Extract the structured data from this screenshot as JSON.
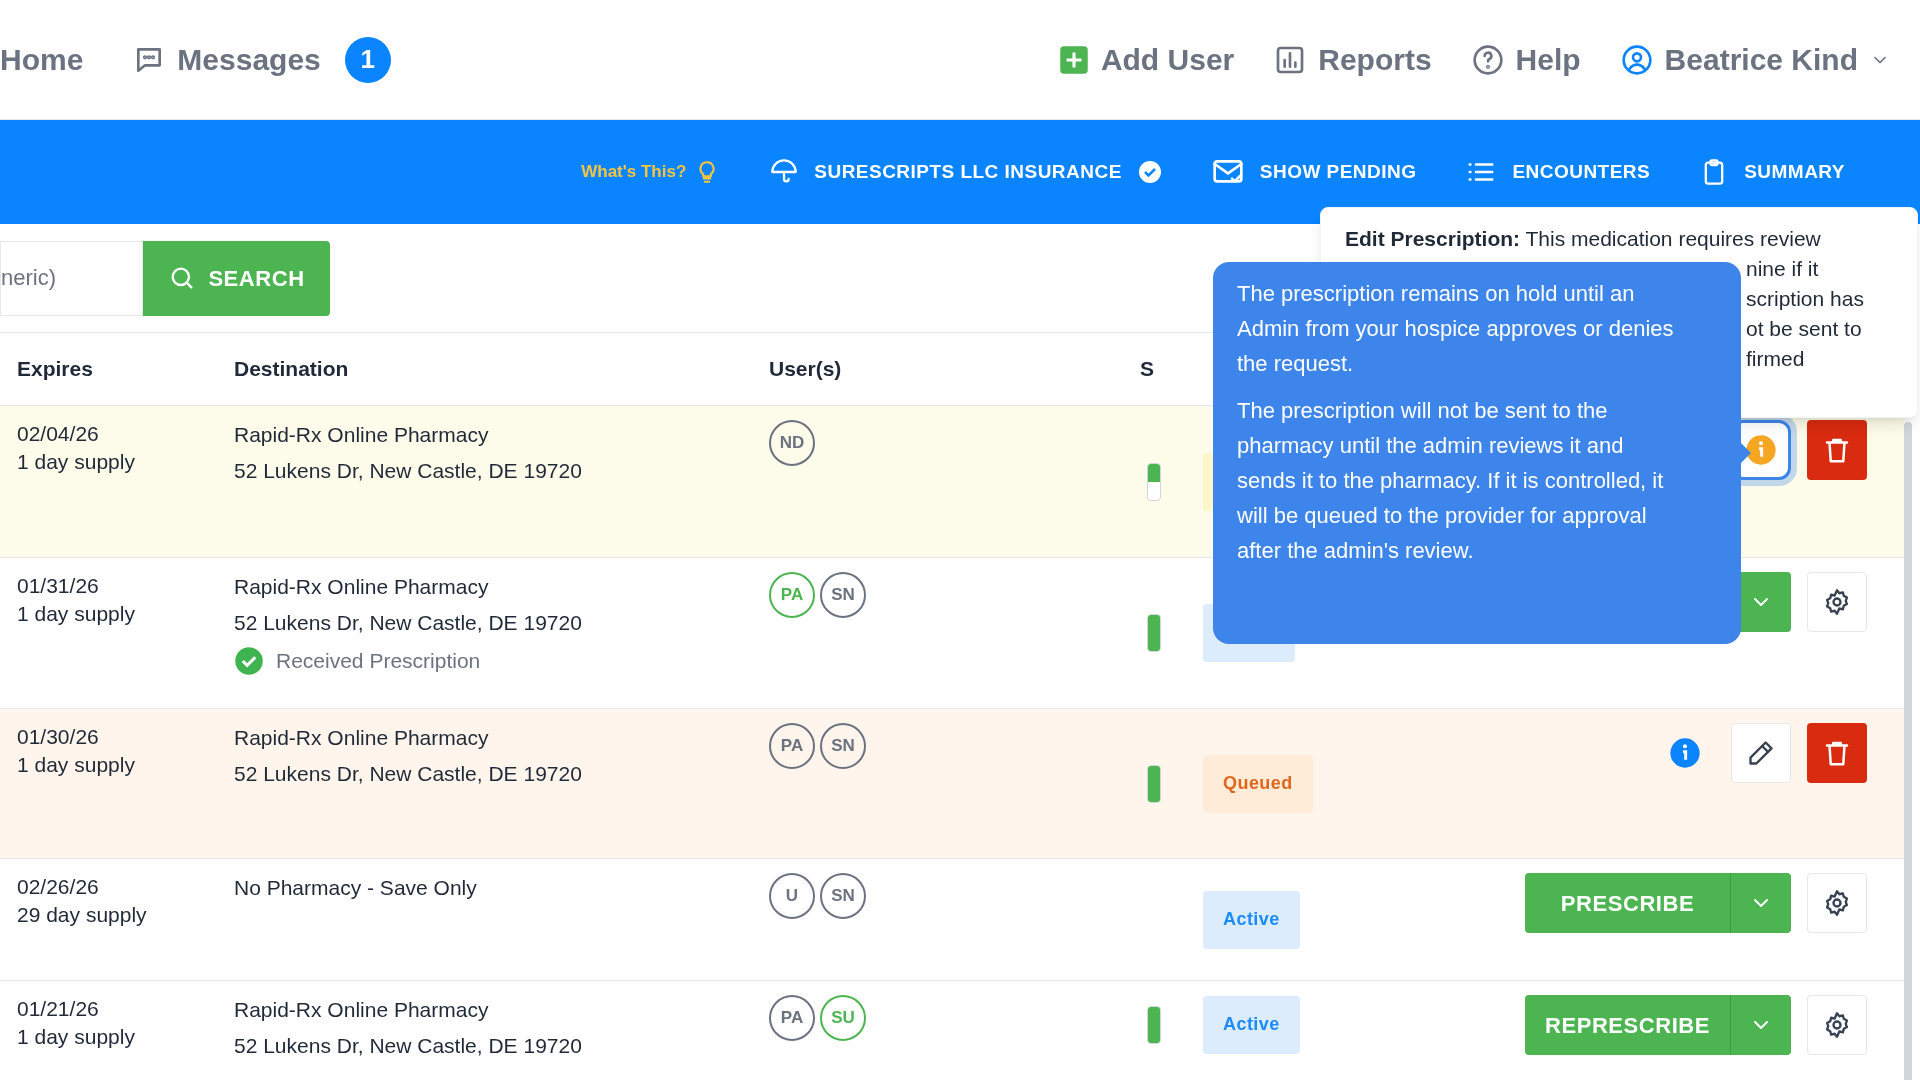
{
  "nav": {
    "left": [
      {
        "kind": "home",
        "label": "Home"
      },
      {
        "kind": "messages",
        "label": "Messages",
        "badge": "1"
      }
    ],
    "right": [
      {
        "kind": "add-user",
        "label": "Add User"
      },
      {
        "kind": "reports",
        "label": "Reports"
      },
      {
        "kind": "help",
        "label": "Help"
      },
      {
        "kind": "user",
        "label": "Beatrice Kind"
      }
    ]
  },
  "toolbar": {
    "hint": "What's This?",
    "items": [
      {
        "kind": "insurance",
        "label": "SURESCRIPTS LLC INSURANCE"
      },
      {
        "kind": "pending",
        "label": "SHOW PENDING"
      },
      {
        "kind": "encounters",
        "label": "ENCOUNTERS"
      },
      {
        "kind": "summary",
        "label": "SUMMARY"
      }
    ]
  },
  "search": {
    "placeholder": "neric)",
    "button": "SEARCH"
  },
  "table": {
    "columns": [
      "Expires",
      "Destination",
      "User(s)",
      "S"
    ],
    "rows": [
      {
        "kind": "hold",
        "expires": "02/04/26",
        "supply": "1 day supply",
        "destination": "Rapid-Rx Online Pharmacy",
        "address": "52 Lukens Dr, New Castle, DE 19720",
        "users": [
          {
            "initials": "ND",
            "color": "#6b7280"
          }
        ],
        "level": 0.5,
        "status": {
          "kind": "hold"
        },
        "actions": [
          {
            "kind": "hold-info"
          },
          {
            "kind": "delete"
          }
        ]
      },
      {
        "kind": "normal",
        "expires": "01/31/26",
        "supply": "1 day supply",
        "destination": "Rapid-Rx Online Pharmacy",
        "address": "52 Lukens Dr, New Castle, DE 19720",
        "note": "Received Prescription",
        "users": [
          {
            "initials": "PA",
            "color": "#4cb552"
          },
          {
            "initials": "SN",
            "color": "#6b7280"
          }
        ],
        "level": 1,
        "status": {
          "kind": "active"
        },
        "actions": [
          {
            "kind": "split"
          },
          {
            "kind": "settings"
          }
        ]
      },
      {
        "kind": "queued",
        "expires": "01/30/26",
        "supply": "1 day supply",
        "destination": "Rapid-Rx Online Pharmacy",
        "address": "52 Lukens Dr, New Castle, DE 19720",
        "users": [
          {
            "initials": "PA",
            "color": "#6b7280"
          },
          {
            "initials": "SN",
            "color": "#6b7280"
          }
        ],
        "level": 1,
        "status": {
          "kind": "queued",
          "label": "Queued"
        },
        "actions": [
          {
            "kind": "info"
          },
          {
            "kind": "edit"
          },
          {
            "kind": "delete"
          }
        ]
      },
      {
        "kind": "normal",
        "expires": "02/26/26",
        "supply": "29 day supply",
        "destination": "No Pharmacy - Save Only",
        "users": [
          {
            "initials": "U",
            "color": "#6b7280"
          },
          {
            "initials": "SN",
            "color": "#6b7280"
          }
        ],
        "status": {
          "kind": "active",
          "label": "Active"
        },
        "actions": [
          {
            "kind": "split",
            "label": "PRESCRIBE"
          },
          {
            "kind": "settings"
          }
        ]
      },
      {
        "kind": "normal",
        "expires": "01/21/26",
        "supply": "1 day supply",
        "destination": "Rapid-Rx Online Pharmacy",
        "address": "52 Lukens Dr, New Castle, DE 19720",
        "users": [
          {
            "initials": "PA",
            "color": "#6b7280"
          },
          {
            "initials": "SU",
            "color": "#4cb552"
          }
        ],
        "level": 1,
        "status": {
          "kind": "active",
          "label": "Active"
        },
        "actions": [
          {
            "kind": "split",
            "label": "REPRESCRIBE"
          },
          {
            "kind": "settings"
          }
        ]
      }
    ]
  },
  "popover": {
    "lines": [
      "**Edit Prescription:** This medication requires review",
      "nine if it",
      "scription has",
      "ot be sent to",
      "firmed"
    ]
  },
  "tooltip": {
    "paragraphs": [
      "The prescription remains on hold until an Admin from your hospice approves or denies the request.",
      "The prescription will not be sent to the pharmacy until the admin reviews it and sends it to the pharmacy. If it is controlled, it will be queued to the provider for approval after the admin's review."
    ]
  }
}
